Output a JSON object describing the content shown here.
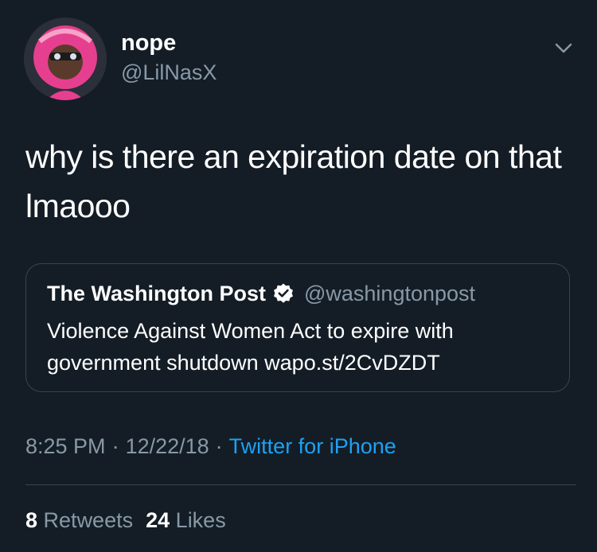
{
  "tweet": {
    "author": {
      "display_name": "nope",
      "handle": "@LilNasX"
    },
    "text": "why is there an expiration date on that lmaooo",
    "quoted": {
      "name": "The Washington Post",
      "handle": "@washingtonpost",
      "text": "Violence Against Women Act to expire with government shutdown wapo.st/2CvDZDT"
    },
    "time": "8:25 PM",
    "date": "12/22/18",
    "separator": "·",
    "source": "Twitter for iPhone",
    "stats": {
      "retweets_count": "8",
      "retweets_label": "Retweets",
      "likes_count": "24",
      "likes_label": "Likes"
    }
  },
  "colors": {
    "background": "#141d26",
    "secondary_text": "#8899a6",
    "accent": "#1da1f2",
    "border": "#38444d"
  },
  "icons": {
    "menu": "chevron-down-icon",
    "verified": "verified-badge-icon"
  }
}
